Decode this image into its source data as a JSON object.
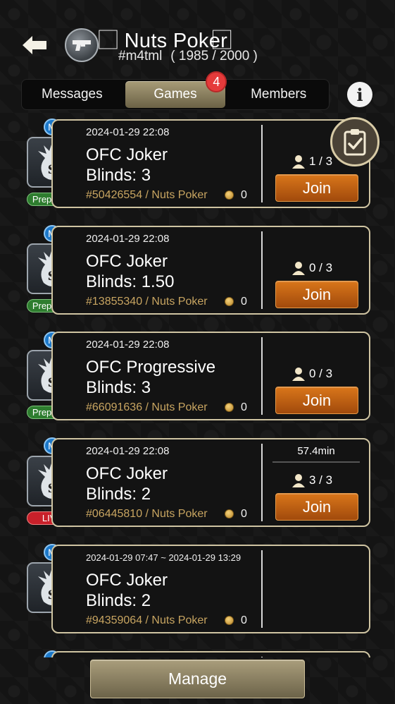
{
  "header": {
    "club_name": "⃞ Nuts Poker ⃞",
    "club_id": "#m4tml",
    "member_count": "( 1985 / 2000 )",
    "back_icon": "back-arrow-icon",
    "logo_icon": "club-logo-icon"
  },
  "tabs": [
    {
      "label": "Messages",
      "active": false
    },
    {
      "label": "Games",
      "active": true,
      "badge": "4"
    },
    {
      "label": "Members",
      "active": false
    }
  ],
  "info_icon": "i",
  "games": [
    {
      "datetime": "2024-01-29 22:08",
      "name": "OFC Joker",
      "blinds": "Blinds: 3",
      "table": "#50426554 / Nuts Poker",
      "coins": "0",
      "players": "1 / 3",
      "status": "Preparing",
      "join": "Join",
      "badge": "M"
    },
    {
      "datetime": "2024-01-29 22:08",
      "name": "OFC Joker",
      "blinds": "Blinds: 1.50",
      "table": "#13855340 / Nuts Poker",
      "coins": "0",
      "players": "0 / 3",
      "status": "Preparing",
      "join": "Join",
      "badge": "M"
    },
    {
      "datetime": "2024-01-29 22:08",
      "name": "OFC Progressive",
      "blinds": "Blinds: 3",
      "table": "#66091636 / Nuts Poker",
      "coins": "0",
      "players": "0 / 3",
      "status": "Preparing",
      "join": "Join",
      "badge": "M"
    },
    {
      "datetime": "2024-01-29 22:08",
      "name": "OFC Joker",
      "blinds": "Blinds: 2",
      "table": "#06445810 / Nuts Poker",
      "coins": "0",
      "players": "3 / 3",
      "status": "LIVE",
      "join": "Join",
      "duration": "57.4min",
      "badge": "M"
    },
    {
      "datetime": "2024-01-29 07:47 ~ 2024-01-29 13:29",
      "name": "OFC Joker",
      "blinds": "Blinds: 2",
      "table": "#94359064 / Nuts Poker",
      "coins": "0",
      "badge": "M"
    }
  ],
  "manage_label": "Manage",
  "colors": {
    "accent_gold": "#cfc4a2",
    "join_orange": "#c8620f",
    "preparing_green": "#2e7d2f",
    "live_red": "#c8202a",
    "badge_red": "#e53b3b",
    "m_badge_blue": "#1c78c9"
  }
}
